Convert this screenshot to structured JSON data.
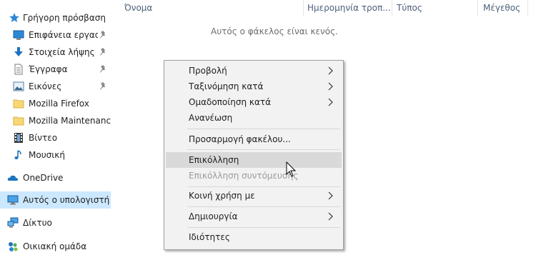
{
  "nav": {
    "items": [
      {
        "label": "Γρήγορη πρόσβαση",
        "icon": "star-icon"
      },
      {
        "label": "Επιφάνεια εργασί",
        "icon": "desktop-icon",
        "pinned": true
      },
      {
        "label": "Στοιχεία λήψης",
        "icon": "download-icon",
        "pinned": true
      },
      {
        "label": "Έγγραφα",
        "icon": "documents-icon",
        "pinned": true
      },
      {
        "label": "Εικόνες",
        "icon": "pictures-icon",
        "pinned": true
      },
      {
        "label": "Mozilla Firefox",
        "icon": "folder-icon"
      },
      {
        "label": "Mozilla Maintenance",
        "icon": "folder-icon"
      },
      {
        "label": "Βίντεο",
        "icon": "video-icon"
      },
      {
        "label": "Μουσική",
        "icon": "music-icon"
      },
      {
        "label": "OneDrive",
        "icon": "onedrive-icon"
      },
      {
        "label": "Αυτός ο υπολογιστής",
        "icon": "computer-icon",
        "selected": true
      },
      {
        "label": "Δίκτυο",
        "icon": "network-icon"
      },
      {
        "label": "Οικιακή ομάδα",
        "icon": "homegroup-icon"
      }
    ]
  },
  "columns": {
    "name": "Όνομα",
    "date": "Ημερομηνία τροπ...",
    "type": "Τύπος",
    "size": "Μέγεθος"
  },
  "empty_message": "Αυτός ο φάκελος είναι κενός.",
  "context_menu": {
    "items": [
      {
        "label": "Προβολή",
        "submenu": true
      },
      {
        "label": "Ταξινόμηση κατά",
        "submenu": true
      },
      {
        "label": "Ομαδοποίηση κατά",
        "submenu": true
      },
      {
        "label": "Ανανέωση"
      },
      {
        "label": "Προσαρμογή φακέλου..."
      },
      {
        "label": "Επικόλληση",
        "hover": true
      },
      {
        "label": "Επικόλληση συντόμευσης",
        "disabled": true
      },
      {
        "label": "Κοινή χρήση με",
        "submenu": true
      },
      {
        "label": "Δημιουργία",
        "submenu": true
      },
      {
        "label": "Ιδιότητες"
      }
    ]
  },
  "colors": {
    "selected_bg": "#cce8ff",
    "menu_bg": "#f2f2f2",
    "menu_hover": "#d9d9d9",
    "header_text": "#4c607a",
    "accent_blue": "#1e73be"
  }
}
